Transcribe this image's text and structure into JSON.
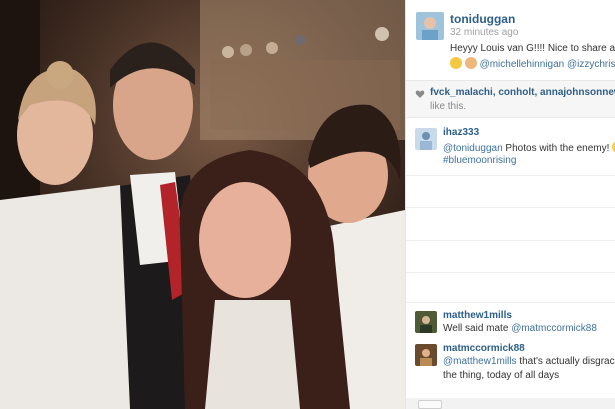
{
  "post": {
    "username": "toniduggan",
    "time": "32 minutes ago",
    "caption_text": "Heyyy Louis van G!!!! Nice to share a w",
    "caption_mentions": "@michellehinnigan @izzychristi"
  },
  "likes": {
    "names": "fvck_malachi, conholt, annajohnsonnew",
    "suffix": "like this."
  },
  "comments": [
    {
      "user": "ihaz333",
      "mention": "@toniduggan",
      "text": " Photos with the enemy! ",
      "tag": "#bluemoonrising"
    },
    {
      "user": "matthew1mills",
      "text": "Well said mate ",
      "mention": "@matmccormick88"
    },
    {
      "user": "matmccormick88",
      "mention": "@matthew1mills",
      "text": " that's actually disgraceful",
      "line2": "the thing, today of all days"
    }
  ],
  "colors": {
    "link": "#2d5f8a",
    "muted": "#a0a0a0",
    "likes_bg": "#f6f6f6"
  }
}
